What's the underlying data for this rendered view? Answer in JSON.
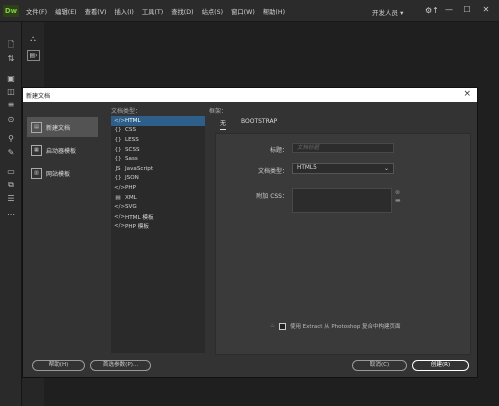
{
  "app": {
    "logo": "Dw",
    "menus": [
      "文件(F)",
      "编辑(E)",
      "查看(V)",
      "插入(I)",
      "工具(T)",
      "查找(D)",
      "站点(S)",
      "窗口(W)",
      "帮助(H)"
    ],
    "workspace": "开发人员 ▾",
    "gear": "⚙↑"
  },
  "dialog": {
    "title": "新建文档",
    "close": "×",
    "sidebar": [
      "新建文档",
      "启动器模板",
      "网站模板"
    ],
    "doctype_label": "文档类型：",
    "doctypes": [
      {
        "icon": "</>",
        "label": "HTML"
      },
      {
        "icon": "{}",
        "label": "CSS"
      },
      {
        "icon": "{}",
        "label": "LESS"
      },
      {
        "icon": "{}",
        "label": "SCSS"
      },
      {
        "icon": "{}",
        "label": "Sass"
      },
      {
        "icon": "JS",
        "label": "JavaScript"
      },
      {
        "icon": "{}",
        "label": "JSON"
      },
      {
        "icon": "</>",
        "label": "PHP"
      },
      {
        "icon": "▤",
        "label": "XML"
      },
      {
        "icon": "</>",
        "label": "SVG"
      },
      {
        "icon": "</>",
        "label": "HTML 模板"
      },
      {
        "icon": "</>",
        "label": "PHP 模板"
      }
    ],
    "selected_doctype": 0,
    "framework_label": "框架：",
    "framework_tabs": [
      "无",
      "BOOTSTRAP"
    ],
    "form": {
      "title_label": "标题：",
      "title_placeholder": "文档标题",
      "doctype_label": "文档类型：",
      "doctype_value": "HTML5",
      "attach_css_label": "附加 CSS："
    },
    "extract_text": "使用 Extract 从 Photoshop 复合中构建页面",
    "buttons": {
      "help": "帮助(H)",
      "preferences": "首选参数(P)...",
      "cancel": "取消(C)",
      "create": "创建(R)"
    }
  }
}
